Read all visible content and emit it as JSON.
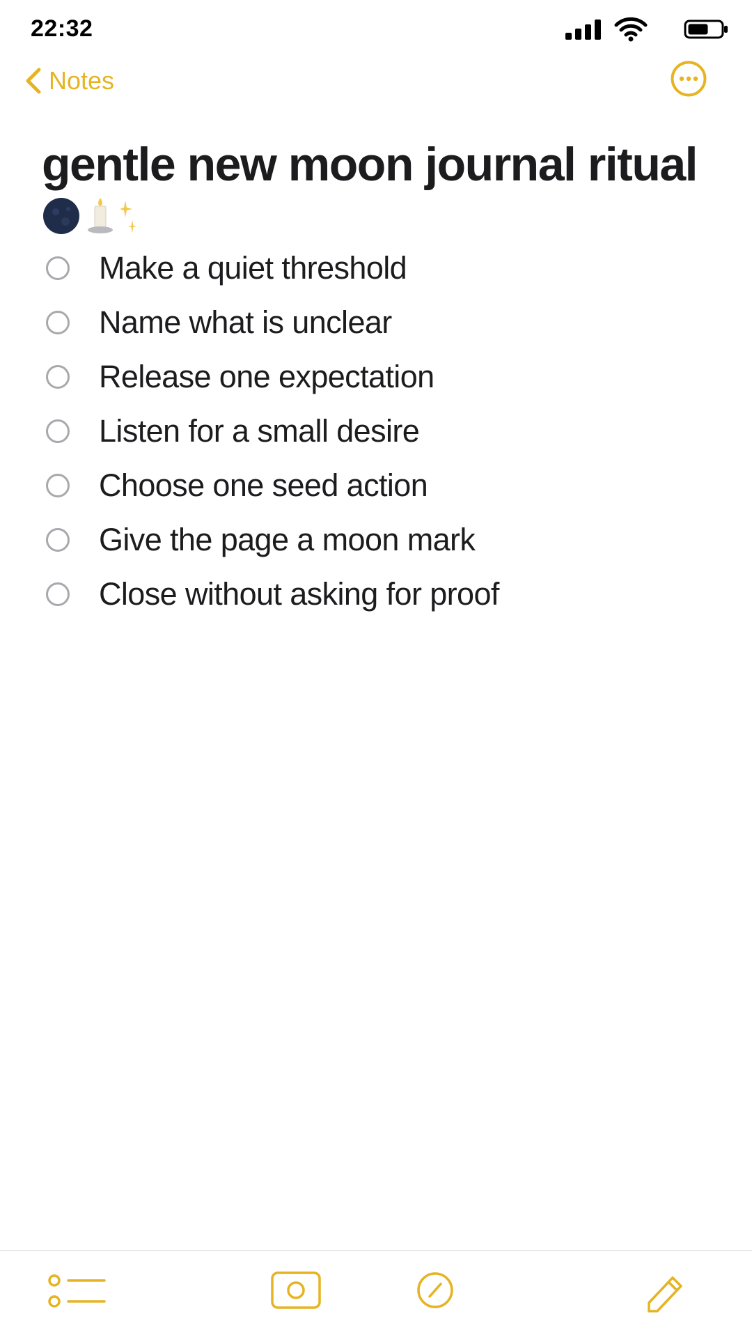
{
  "status_bar": {
    "time": "22:32",
    "icons": [
      "signal-icon",
      "wifi-icon",
      "battery-icon"
    ]
  },
  "nav": {
    "back_label": "Notes",
    "back_icon": "chevron-left-icon",
    "more_icon": "ellipsis-circle-icon"
  },
  "note": {
    "title": "gentle new moon journal ritual",
    "title_emoji": [
      "new-moon-icon",
      "candle-icon",
      "sparkles-icon"
    ],
    "checklist": [
      {
        "text": "Make a quiet threshold",
        "checked": false
      },
      {
        "text": "Name what is unclear",
        "checked": false
      },
      {
        "text": "Release one expectation",
        "checked": false
      },
      {
        "text": "Listen for a small desire",
        "checked": false
      },
      {
        "text": "Choose one seed action",
        "checked": false
      },
      {
        "text": "Give the page a moon mark",
        "checked": false
      },
      {
        "text": "Close without asking for proof",
        "checked": false
      }
    ]
  },
  "toolbar": {
    "icons": [
      "checklist-icon",
      "camera-icon",
      "markup-icon",
      "compose-icon"
    ]
  },
  "colors": {
    "accent": "#e6b422",
    "text": "#1c1c1e",
    "checkbox_border": "#a8a8ad",
    "background": "#ffffff"
  }
}
